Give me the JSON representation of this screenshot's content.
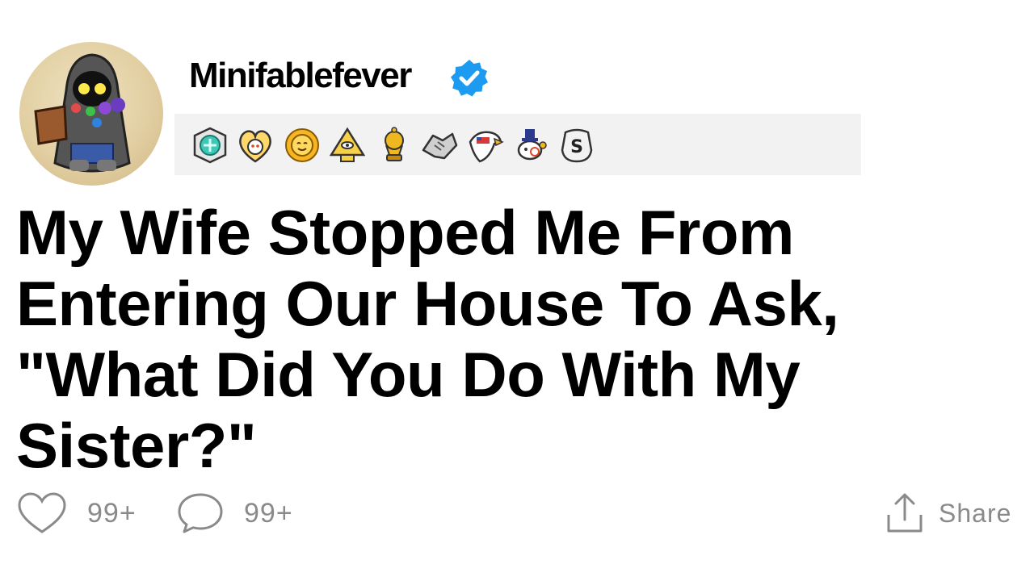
{
  "post": {
    "username": "Minifablefever",
    "verified": true,
    "title": "My Wife Stopped Me From Entering Our House To Ask, \"What Did You Do With My Sister?\"",
    "awards": [
      "rainbow-gem-award-icon",
      "wholesome-heart-award-icon",
      "sun-award-icon",
      "illuminati-pyramid-award-icon",
      "gold-trophy-award-icon",
      "handshake-award-icon",
      "eagle-award-icon",
      "snoo-rich-award-icon",
      "silver-s-award-icon"
    ]
  },
  "actions": {
    "likes": "99+",
    "comments": "99+",
    "share_label": "Share"
  },
  "colors": {
    "verified_blue": "#1d9bf0",
    "action_gray": "#8a8a8a",
    "awards_bg": "#f2f2f2"
  }
}
